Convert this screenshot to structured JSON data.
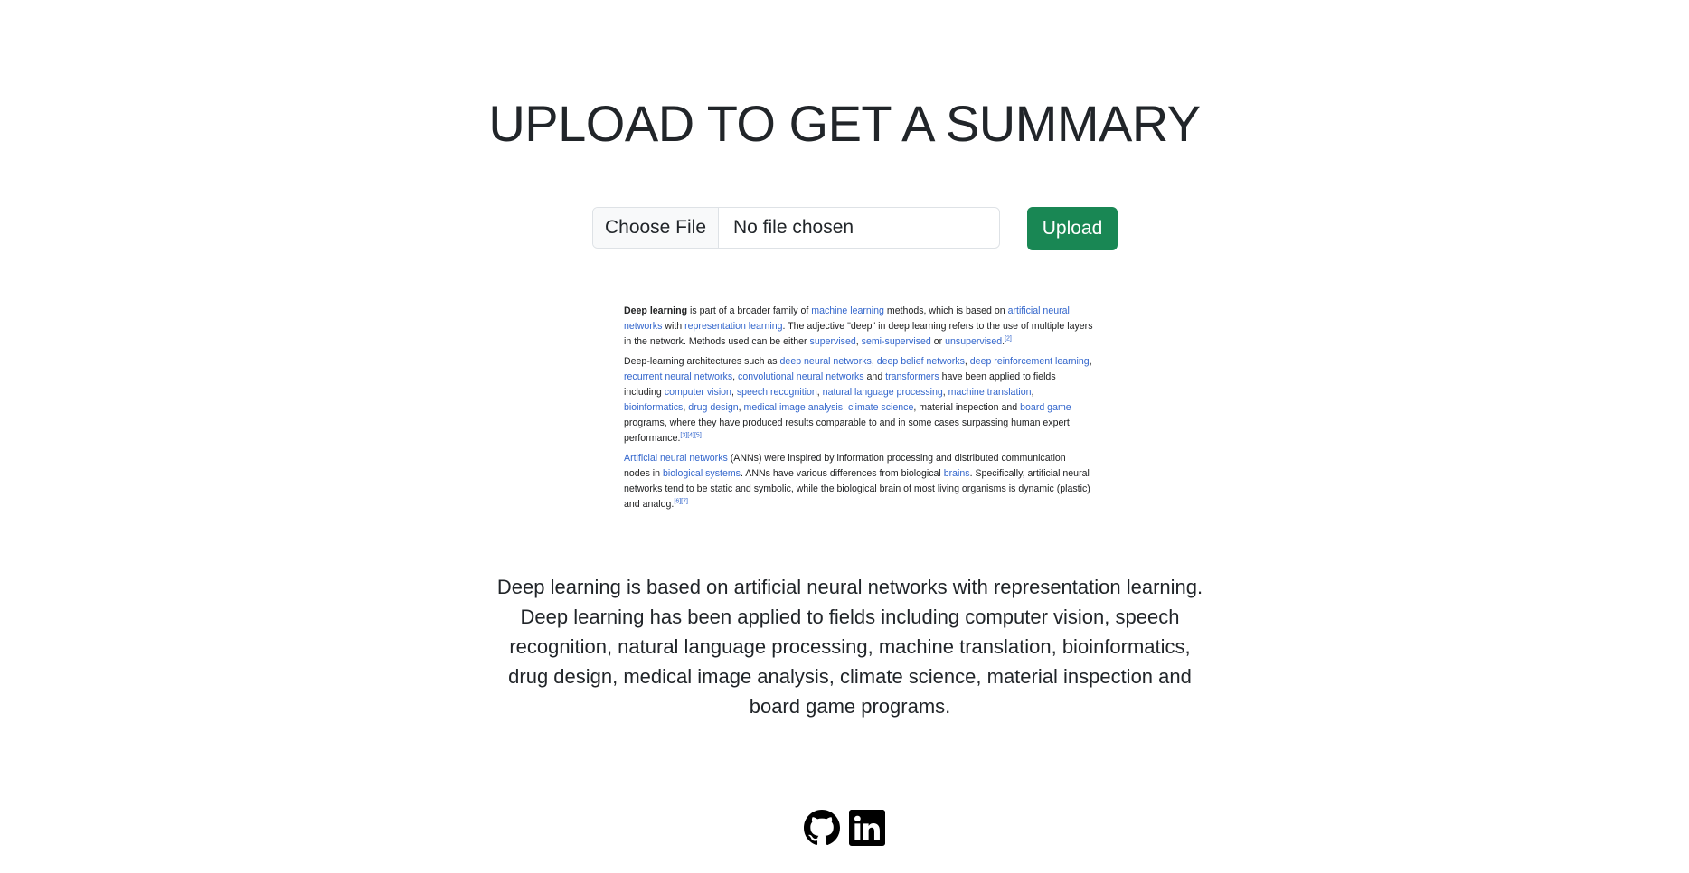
{
  "header": {
    "title": "UPLOAD TO GET A SUMMARY"
  },
  "upload": {
    "choose_label": "Choose File",
    "file_status": "No file chosen",
    "upload_label": "Upload",
    "upload_color": "#198754"
  },
  "preview": {
    "p1": {
      "term": "Deep learning",
      "t1": " is part of a broader family of ",
      "l1": "machine learning",
      "t2": " methods, which is based on ",
      "l2": "artificial neural networks",
      "t3": " with ",
      "l3": "representation learning",
      "t4": ". The adjective \"deep\" in deep learning refers to the use of multiple layers in the network. Methods used can be either ",
      "l4": "supervised",
      "t5": ", ",
      "l5": "semi-supervised",
      "t6": " or ",
      "l6": "unsupervised",
      "t7": ".",
      "ref": "[2]"
    },
    "p2": {
      "t1": "Deep-learning architectures such as ",
      "l1": "deep neural networks",
      "s1": ", ",
      "l2": "deep belief networks",
      "s2": ", ",
      "l3": "deep reinforcement learning",
      "s3": ", ",
      "l4": "recurrent neural networks",
      "s4": ", ",
      "l5": "convolutional neural networks",
      "t2": " and ",
      "l6": "transformers",
      "t3": " have been applied to fields including ",
      "l7": "computer vision",
      "s5": ", ",
      "l8": "speech recognition",
      "s6": ", ",
      "l9": "natural language processing",
      "s7": ", ",
      "l10": "machine translation",
      "s8": ", ",
      "l11": "bioinformatics",
      "s9": ", ",
      "l12": "drug design",
      "s10": ", ",
      "l13": "medical image analysis",
      "s11": ", ",
      "l14": "climate science",
      "t4": ", material inspection and ",
      "l15": "board game",
      "t5": " programs, where they have produced results comparable to and in some cases surpassing human expert performance.",
      "ref": "[3][4][5]"
    },
    "p3": {
      "l1": "Artificial neural networks",
      "t1": " (ANNs) were inspired by information processing and distributed communication nodes in ",
      "l2": "biological systems",
      "t2": ". ANNs have various differences from biological ",
      "l3": "brains",
      "t3": ". Specifically, artificial neural networks tend to be static and symbolic, while the biological brain of most living organisms is dynamic (plastic) and analog.",
      "ref": "[6][7]"
    }
  },
  "summary": {
    "text": "Deep learning is based on artificial neural networks with representation learning. Deep learning has been applied to fields including computer vision, speech recognition, natural language processing, machine translation, bioinformatics, drug design, medical image analysis, climate science, material inspection and board game programs."
  },
  "footer": {
    "icons": [
      "github-icon",
      "linkedin-icon"
    ]
  }
}
